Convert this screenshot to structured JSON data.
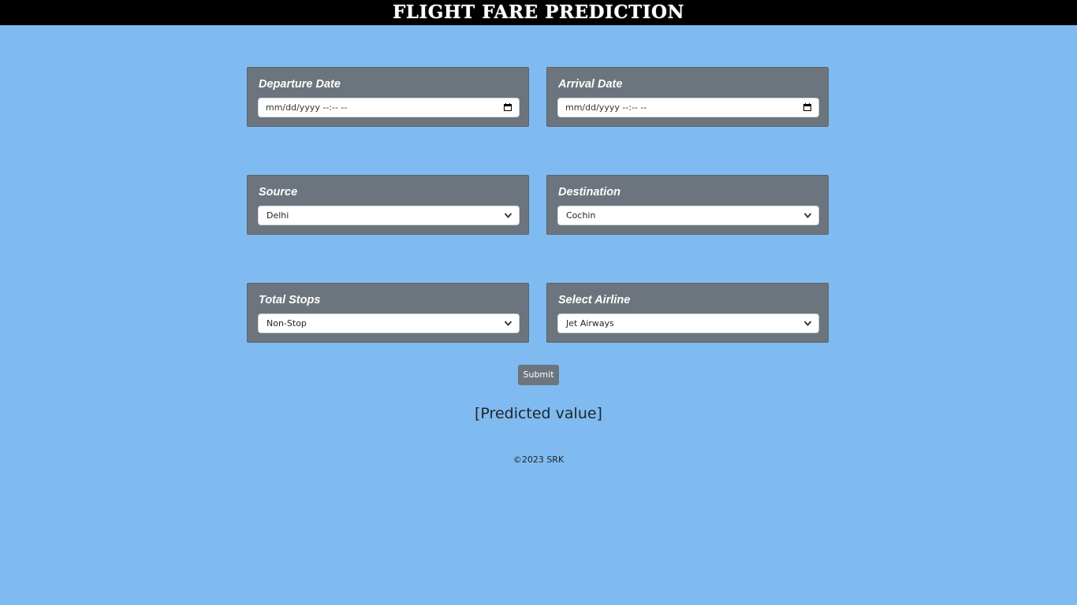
{
  "header": {
    "title": "FLIGHT FARE PREDICTION"
  },
  "form": {
    "departure": {
      "label": "Departure Date",
      "placeholder": "mm/dd/yyyy --:-- --"
    },
    "arrival": {
      "label": "Arrival Date",
      "placeholder": "mm/dd/yyyy --:-- --"
    },
    "source": {
      "label": "Source",
      "selected": "Delhi"
    },
    "destination": {
      "label": "Destination",
      "selected": "Cochin"
    },
    "stops": {
      "label": "Total Stops",
      "selected": "Non-Stop"
    },
    "airline": {
      "label": "Select Airline",
      "selected": "Jet Airways"
    },
    "submit_label": "Submit"
  },
  "result": {
    "text": "[Predicted value]"
  },
  "footer": {
    "text": "©2023 SRK"
  },
  "colors": {
    "background": "#7fbbf0",
    "topbar": "#000000",
    "card": "#6c757d",
    "button": "#6c757d"
  },
  "icons": {
    "date_picker": "calendar-icon",
    "dropdown": "chevron-down-icon"
  }
}
